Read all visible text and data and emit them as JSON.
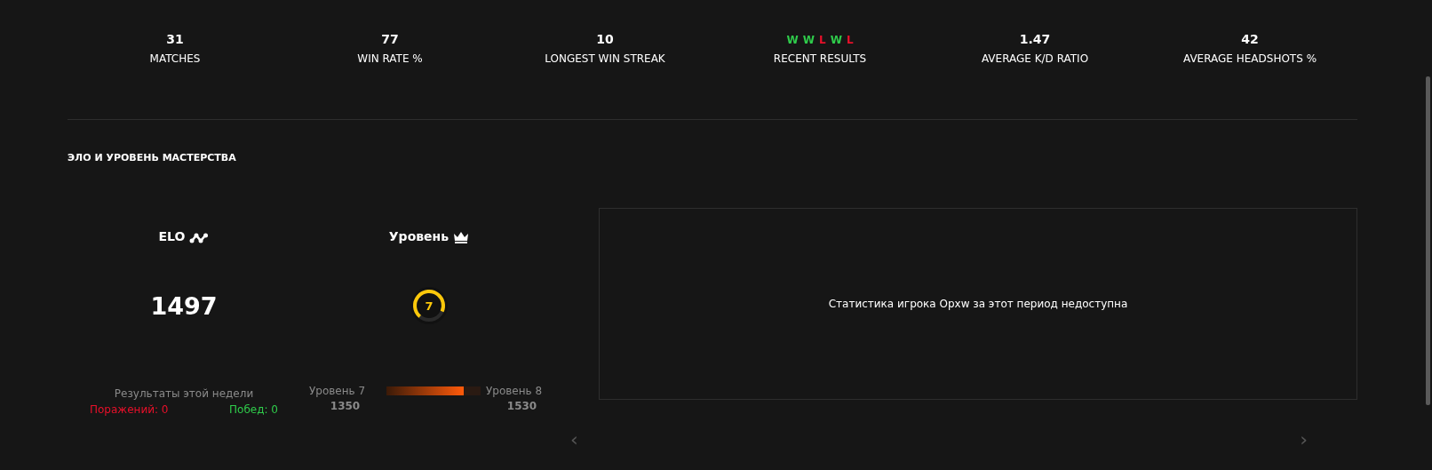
{
  "stats": [
    {
      "value": "31",
      "label": "MATCHES"
    },
    {
      "value": "77",
      "label": "WIN RATE %"
    },
    {
      "value": "10",
      "label": "LONGEST WIN STREAK"
    },
    {
      "results": [
        {
          "text": "W",
          "kind": "win"
        },
        {
          "text": "W",
          "kind": "win"
        },
        {
          "text": "L",
          "kind": "loss"
        },
        {
          "text": "W",
          "kind": "win"
        },
        {
          "text": "L",
          "kind": "loss"
        }
      ],
      "label": "RECENT RESULTS"
    },
    {
      "value": "1.47",
      "label": "AVERAGE K/D RATIO"
    },
    {
      "value": "42",
      "label": "AVERAGE HEADSHOTS %"
    }
  ],
  "section_title": "ЭЛО И УРОВЕНЬ МАСТЕРСТВА",
  "elo": {
    "title": "ELO",
    "value": "1497",
    "week_title": "Результаты этой недели",
    "losses": "Поражений: 0",
    "wins": "Побед: 0"
  },
  "level": {
    "title": "Уровень",
    "badge": "7",
    "from_label": "Уровень 7",
    "from_value": "1350",
    "to_label": "Уровень 8",
    "to_value": "1530",
    "level": 0.82
  },
  "chart_panel": {
    "message": "Статистика игрока Opxw за этот период недоступна"
  },
  "nav": {
    "prev": "‹",
    "next": "›"
  }
}
